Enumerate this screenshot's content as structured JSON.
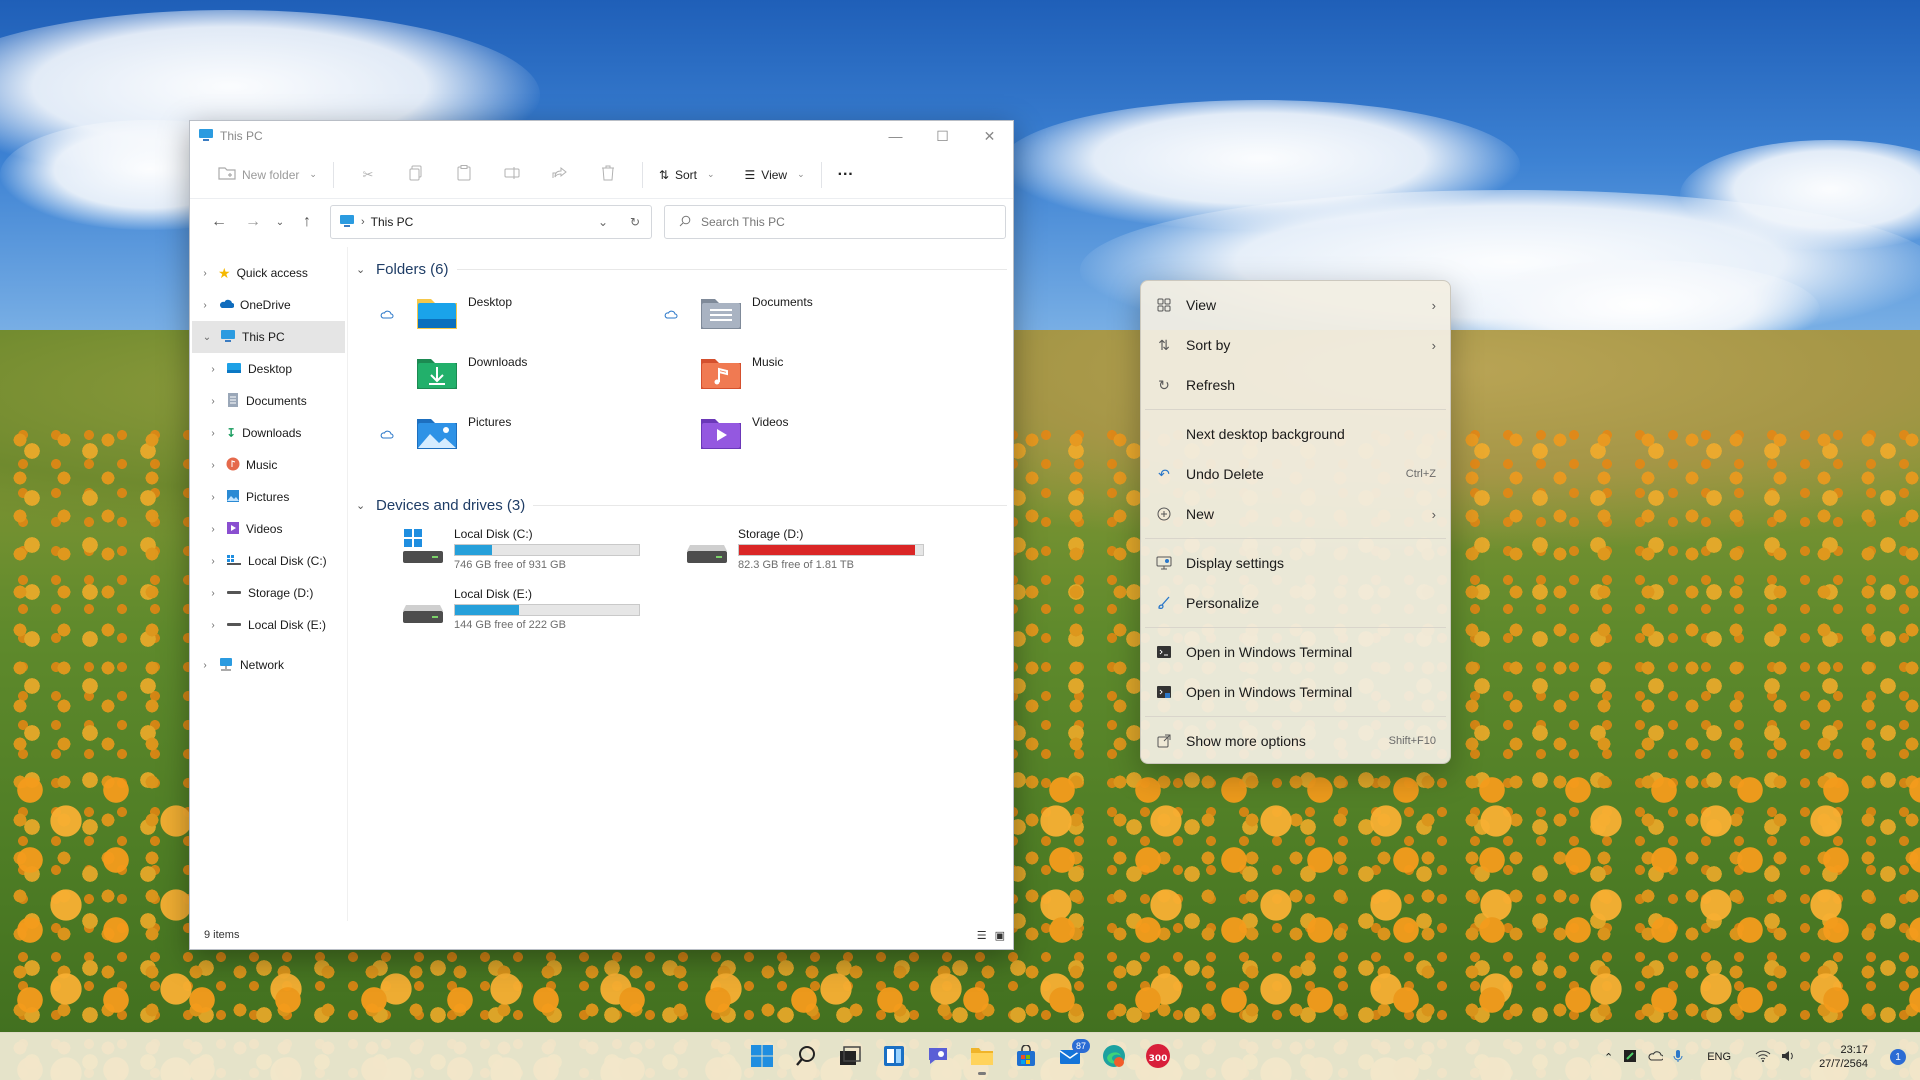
{
  "explorer": {
    "title": "This PC",
    "toolbar": {
      "new_folder": "New folder",
      "sort": "Sort",
      "view": "View",
      "more": "···"
    },
    "address": {
      "path": "This PC"
    },
    "search": {
      "placeholder": "Search This PC"
    },
    "nav": [
      {
        "label": "Quick access",
        "icon": "star-icon",
        "level": 0
      },
      {
        "label": "OneDrive",
        "icon": "onedrive-cloud-icon",
        "level": 0
      },
      {
        "label": "This PC",
        "icon": "monitor-icon",
        "level": 0,
        "selected": true,
        "expanded": true
      },
      {
        "label": "Desktop",
        "icon": "desktop-folder-icon",
        "level": 1
      },
      {
        "label": "Documents",
        "icon": "documents-icon",
        "level": 1
      },
      {
        "label": "Downloads",
        "icon": "download-arrow-icon",
        "level": 1
      },
      {
        "label": "Music",
        "icon": "music-icon",
        "level": 1
      },
      {
        "label": "Pictures",
        "icon": "pictures-icon",
        "level": 1
      },
      {
        "label": "Videos",
        "icon": "videos-icon",
        "level": 1
      },
      {
        "label": "Local Disk (C:)",
        "icon": "windows-drive-icon",
        "level": 1
      },
      {
        "label": "Storage (D:)",
        "icon": "drive-icon",
        "level": 1
      },
      {
        "label": "Local Disk (E:)",
        "icon": "drive-icon",
        "level": 1
      },
      {
        "label": "Network",
        "icon": "network-icon",
        "level": 0
      }
    ],
    "folders_header": "Folders (6)",
    "folders": [
      {
        "name": "Desktop",
        "icon": "desktop-folder-icon",
        "cloud": true
      },
      {
        "name": "Documents",
        "icon": "documents-folder-icon",
        "cloud": true
      },
      {
        "name": "Downloads",
        "icon": "downloads-folder-icon",
        "cloud": false
      },
      {
        "name": "Music",
        "icon": "music-folder-icon",
        "cloud": false
      },
      {
        "name": "Pictures",
        "icon": "pictures-folder-icon",
        "cloud": true
      },
      {
        "name": "Videos",
        "icon": "videos-folder-icon",
        "cloud": false
      }
    ],
    "drives_header": "Devices and drives (3)",
    "drives": [
      {
        "name": "Local Disk (C:)",
        "free_text": "746 GB free of 931 GB",
        "used_fraction": 0.2,
        "bar_color": "#26a0da"
      },
      {
        "name": "Storage (D:)",
        "free_text": "82.3 GB free of 1.81 TB",
        "used_fraction": 0.955,
        "bar_color": "#da2626"
      },
      {
        "name": "Local Disk (E:)",
        "free_text": "144 GB free of 222 GB",
        "used_fraction": 0.35,
        "bar_color": "#26a0da"
      }
    ],
    "status": {
      "items": "9 items"
    }
  },
  "context_menu": {
    "items": [
      {
        "label": "View",
        "icon": "grid-icon",
        "submenu": true
      },
      {
        "label": "Sort by",
        "icon": "sort-arrows-icon",
        "submenu": true
      },
      {
        "label": "Refresh",
        "icon": "refresh-icon"
      },
      {
        "separator": true
      },
      {
        "label": "Next desktop background",
        "icon": ""
      },
      {
        "label": "Undo Delete",
        "icon": "undo-icon",
        "shortcut": "Ctrl+Z"
      },
      {
        "label": "New",
        "icon": "plus-circle-icon",
        "submenu": true
      },
      {
        "separator": true
      },
      {
        "label": "Display settings",
        "icon": "display-settings-icon"
      },
      {
        "label": "Personalize",
        "icon": "brush-icon"
      },
      {
        "separator": true
      },
      {
        "label": "Open in Windows Terminal",
        "icon": "terminal-icon"
      },
      {
        "label": "Open in Windows Terminal",
        "icon": "terminal-admin-icon"
      },
      {
        "separator": true
      },
      {
        "label": "Show more options",
        "icon": "show-more-icon",
        "shortcut": "Shift+F10"
      }
    ]
  },
  "taskbar": {
    "apps": [
      {
        "name": "start-button",
        "icon": "windows-logo-icon"
      },
      {
        "name": "search-button",
        "icon": "search-icon"
      },
      {
        "name": "task-view-button",
        "icon": "task-view-icon"
      },
      {
        "name": "widgets-button",
        "icon": "widgets-icon"
      },
      {
        "name": "chat-button",
        "icon": "chat-icon"
      },
      {
        "name": "file-explorer-button",
        "icon": "folder-icon",
        "active": true
      },
      {
        "name": "store-button",
        "icon": "store-icon"
      },
      {
        "name": "mail-button",
        "icon": "mail-icon",
        "badge": "87"
      },
      {
        "name": "edge-button",
        "icon": "edge-icon"
      },
      {
        "name": "app-300-button",
        "icon": "app-300-icon"
      }
    ],
    "tray": {
      "language": "ENG",
      "time": "23:17",
      "date": "27/7/2564",
      "notifications": "1"
    }
  },
  "colors": {
    "accent": "#0067c0",
    "drive_ok": "#26a0da",
    "drive_full": "#da2626"
  }
}
